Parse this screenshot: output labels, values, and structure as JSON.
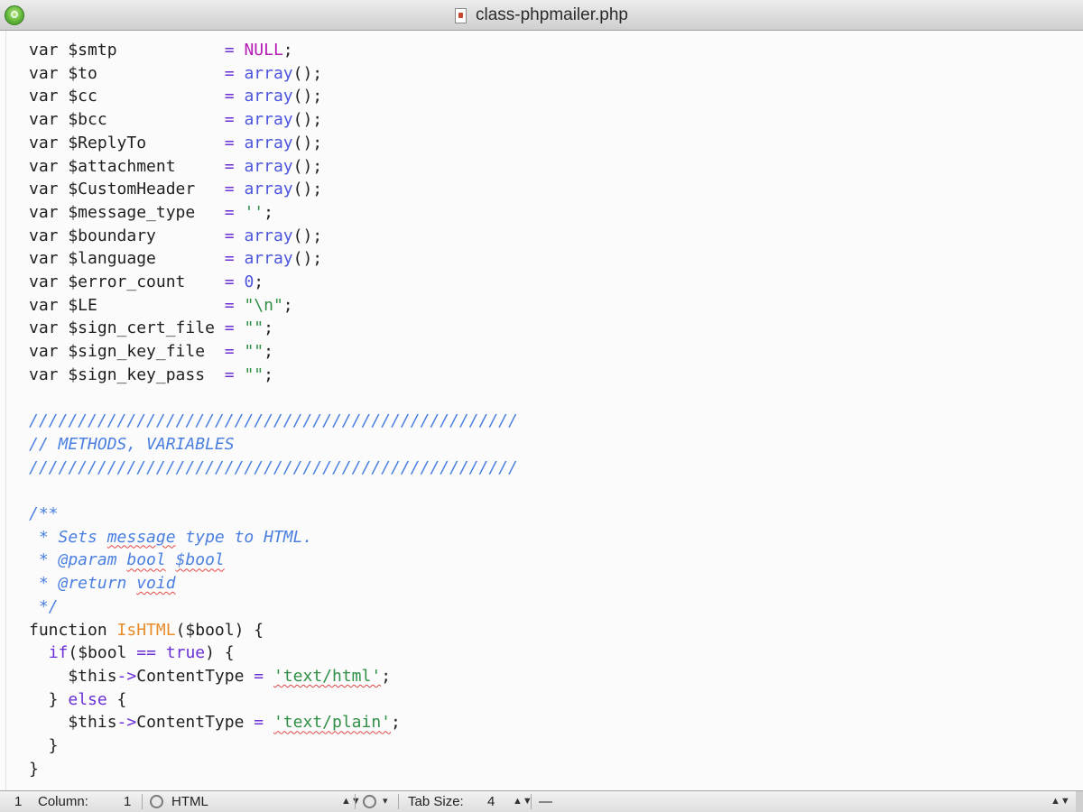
{
  "window": {
    "title": "class-phpmailer.php"
  },
  "colors": {
    "keyword": "#6a2fd6",
    "null_constant": "#b51bb5",
    "function_call": "#4b55dd",
    "string": "#2f8f45",
    "comment": "#4a7fe0",
    "function_name": "#e98d2c"
  },
  "code": {
    "lines": [
      [
        {
          "t": "var $smtp           ",
          "k": "plain"
        },
        {
          "t": "= ",
          "k": "op"
        },
        {
          "t": "NULL",
          "k": "null"
        },
        {
          "t": ";",
          "k": "plain"
        }
      ],
      [
        {
          "t": "var $to             ",
          "k": "plain"
        },
        {
          "t": "= ",
          "k": "op"
        },
        {
          "t": "array",
          "k": "func"
        },
        {
          "t": "();",
          "k": "plain"
        }
      ],
      [
        {
          "t": "var $cc             ",
          "k": "plain"
        },
        {
          "t": "= ",
          "k": "op"
        },
        {
          "t": "array",
          "k": "func"
        },
        {
          "t": "();",
          "k": "plain"
        }
      ],
      [
        {
          "t": "var $bcc            ",
          "k": "plain"
        },
        {
          "t": "= ",
          "k": "op"
        },
        {
          "t": "array",
          "k": "func"
        },
        {
          "t": "();",
          "k": "plain"
        }
      ],
      [
        {
          "t": "var $ReplyTo        ",
          "k": "plain"
        },
        {
          "t": "= ",
          "k": "op"
        },
        {
          "t": "array",
          "k": "func"
        },
        {
          "t": "();",
          "k": "plain"
        }
      ],
      [
        {
          "t": "var $attachment     ",
          "k": "plain"
        },
        {
          "t": "= ",
          "k": "op"
        },
        {
          "t": "array",
          "k": "func"
        },
        {
          "t": "();",
          "k": "plain"
        }
      ],
      [
        {
          "t": "var $CustomHeader   ",
          "k": "plain"
        },
        {
          "t": "= ",
          "k": "op"
        },
        {
          "t": "array",
          "k": "func"
        },
        {
          "t": "();",
          "k": "plain"
        }
      ],
      [
        {
          "t": "var $message_type   ",
          "k": "plain"
        },
        {
          "t": "= ",
          "k": "op"
        },
        {
          "t": "''",
          "k": "str"
        },
        {
          "t": ";",
          "k": "plain"
        }
      ],
      [
        {
          "t": "var $boundary       ",
          "k": "plain"
        },
        {
          "t": "= ",
          "k": "op"
        },
        {
          "t": "array",
          "k": "func"
        },
        {
          "t": "();",
          "k": "plain"
        }
      ],
      [
        {
          "t": "var $language       ",
          "k": "plain"
        },
        {
          "t": "= ",
          "k": "op"
        },
        {
          "t": "array",
          "k": "func"
        },
        {
          "t": "();",
          "k": "plain"
        }
      ],
      [
        {
          "t": "var $error_count    ",
          "k": "plain"
        },
        {
          "t": "= ",
          "k": "op"
        },
        {
          "t": "0",
          "k": "num"
        },
        {
          "t": ";",
          "k": "plain"
        }
      ],
      [
        {
          "t": "var $LE             ",
          "k": "plain"
        },
        {
          "t": "= ",
          "k": "op"
        },
        {
          "t": "\"\\n\"",
          "k": "str"
        },
        {
          "t": ";",
          "k": "plain"
        }
      ],
      [
        {
          "t": "var $sign_cert_file ",
          "k": "plain"
        },
        {
          "t": "= ",
          "k": "op"
        },
        {
          "t": "\"\"",
          "k": "str"
        },
        {
          "t": ";",
          "k": "plain"
        }
      ],
      [
        {
          "t": "var $sign_key_file  ",
          "k": "plain"
        },
        {
          "t": "= ",
          "k": "op"
        },
        {
          "t": "\"\"",
          "k": "str"
        },
        {
          "t": ";",
          "k": "plain"
        }
      ],
      [
        {
          "t": "var $sign_key_pass  ",
          "k": "plain"
        },
        {
          "t": "= ",
          "k": "op"
        },
        {
          "t": "\"\"",
          "k": "str"
        },
        {
          "t": ";",
          "k": "plain"
        }
      ],
      [],
      [
        {
          "t": "//////////////////////////////////////////////////",
          "k": "comment"
        }
      ],
      [
        {
          "t": "// METHODS, VARIABLES",
          "k": "comment"
        }
      ],
      [
        {
          "t": "//////////////////////////////////////////////////",
          "k": "comment"
        }
      ],
      [],
      [
        {
          "t": "/**",
          "k": "comment"
        }
      ],
      [
        {
          "t": " * Sets ",
          "k": "comment"
        },
        {
          "t": "message",
          "k": "comment",
          "s": true
        },
        {
          "t": " type to HTML.",
          "k": "comment"
        }
      ],
      [
        {
          "t": " * @param ",
          "k": "comment"
        },
        {
          "t": "bool",
          "k": "comment",
          "s": true
        },
        {
          "t": " ",
          "k": "comment"
        },
        {
          "t": "$bool",
          "k": "comment",
          "s": true
        }
      ],
      [
        {
          "t": " * @return ",
          "k": "comment"
        },
        {
          "t": "void",
          "k": "comment",
          "s": true
        }
      ],
      [
        {
          "t": " */",
          "k": "comment"
        }
      ],
      [
        {
          "t": "function ",
          "k": "plain"
        },
        {
          "t": "IsHTML",
          "k": "name"
        },
        {
          "t": "($bool) {",
          "k": "plain"
        }
      ],
      [
        {
          "t": "  ",
          "k": "plain"
        },
        {
          "t": "if",
          "k": "kw"
        },
        {
          "t": "($bool ",
          "k": "plain"
        },
        {
          "t": "==",
          "k": "op"
        },
        {
          "t": " ",
          "k": "plain"
        },
        {
          "t": "true",
          "k": "kw"
        },
        {
          "t": ") {",
          "k": "plain"
        }
      ],
      [
        {
          "t": "    $this",
          "k": "plain"
        },
        {
          "t": "->",
          "k": "op"
        },
        {
          "t": "ContentType ",
          "k": "plain"
        },
        {
          "t": "=",
          "k": "op"
        },
        {
          "t": " ",
          "k": "plain"
        },
        {
          "t": "'text/html'",
          "k": "str",
          "s": true
        },
        {
          "t": ";",
          "k": "plain"
        }
      ],
      [
        {
          "t": "  } ",
          "k": "plain"
        },
        {
          "t": "else",
          "k": "kw"
        },
        {
          "t": " {",
          "k": "plain"
        }
      ],
      [
        {
          "t": "    $this",
          "k": "plain"
        },
        {
          "t": "->",
          "k": "op"
        },
        {
          "t": "ContentType ",
          "k": "plain"
        },
        {
          "t": "=",
          "k": "op"
        },
        {
          "t": " ",
          "k": "plain"
        },
        {
          "t": "'text/plain'",
          "k": "str",
          "s": true
        },
        {
          "t": ";",
          "k": "plain"
        }
      ],
      [
        {
          "t": "  }",
          "k": "plain"
        }
      ],
      [
        {
          "t": "}",
          "k": "plain"
        }
      ]
    ]
  },
  "status": {
    "line": "1",
    "column_label": "Column:",
    "column": "1",
    "language": "HTML",
    "tab_size_label": "Tab Size:",
    "tab_size": "4",
    "symbol": "—",
    "up_down": "▲▼",
    "gear_menu": "▾"
  }
}
